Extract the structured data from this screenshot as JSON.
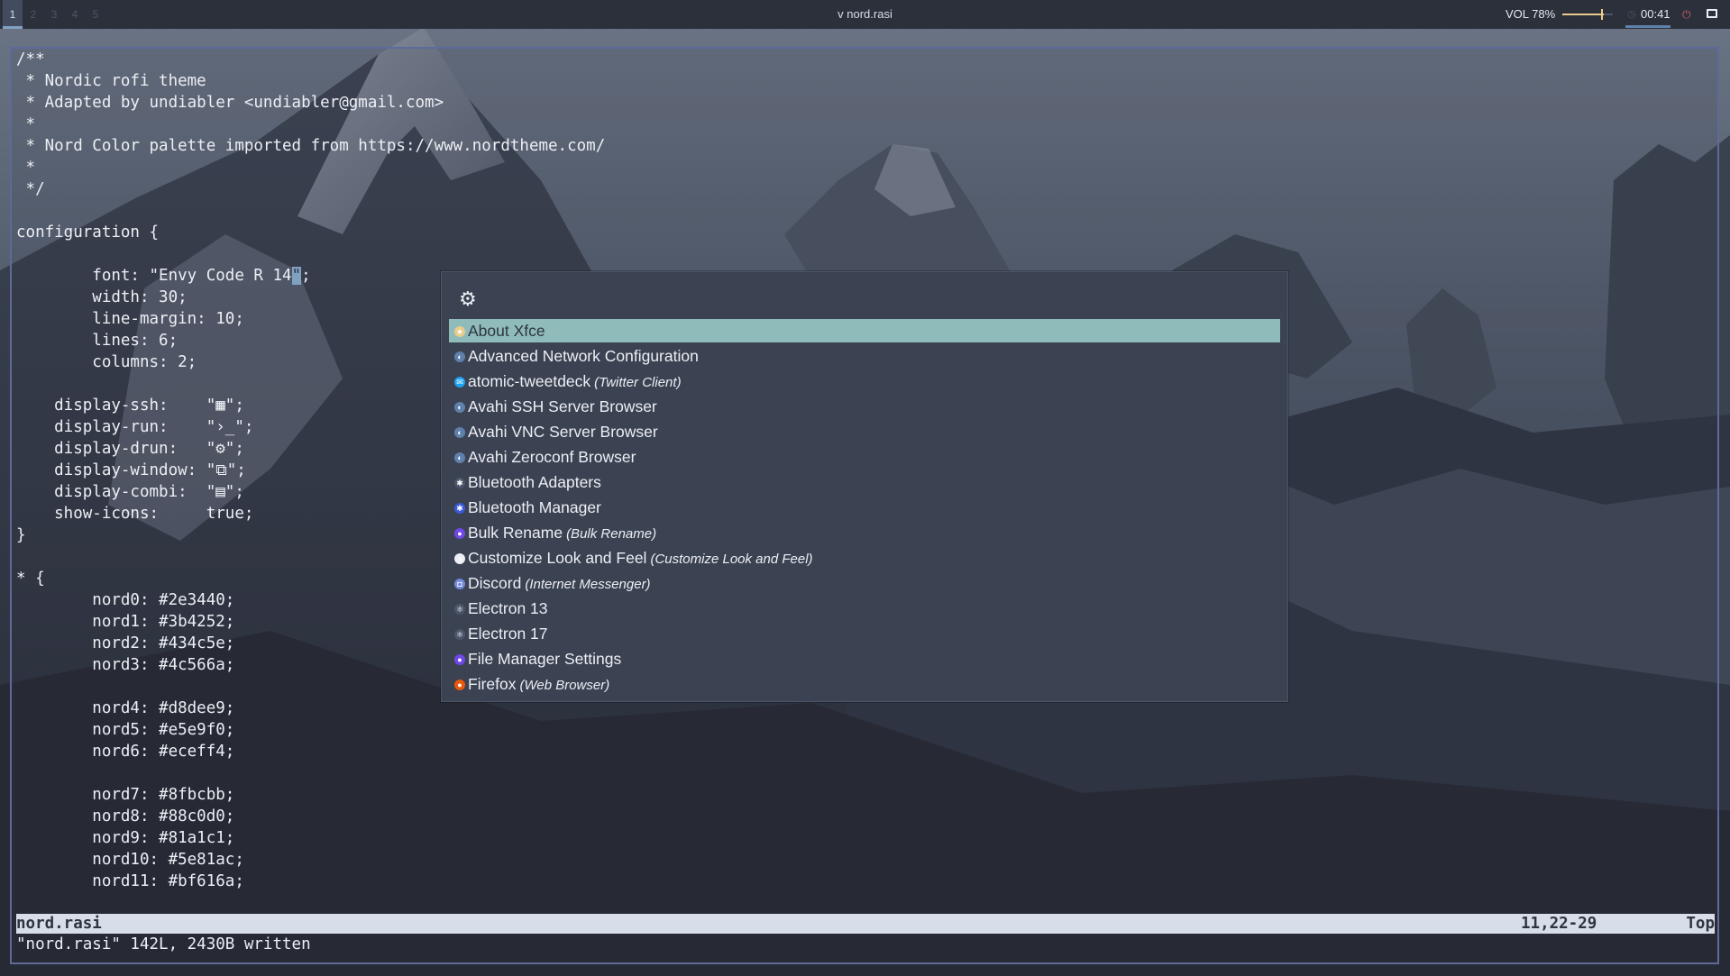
{
  "topbar": {
    "workspaces": [
      "1",
      "2",
      "3",
      "4",
      "5"
    ],
    "active_workspace": "1",
    "window_title": "v nord.rasi",
    "volume": "VOL 78%",
    "volume_level": 0.78,
    "clock": "00:41",
    "icons": [
      "clock-icon",
      "power-icon",
      "display-icon"
    ]
  },
  "editor": {
    "lines": [
      "/**",
      " * Nordic rofi theme",
      " * Adapted by undiabler <undiabler@gmail.com>",
      " *",
      " * Nord Color palette imported from https://www.nordtheme.com/",
      " *",
      " */",
      "",
      "configuration {",
      "",
      "        font: \"Envy Code R 14\";",
      "        width: 30;",
      "        line-margin: 10;",
      "        lines: 6;",
      "        columns: 2;",
      "",
      "    display-ssh:    \"▦\";",
      "    display-run:    \"›_\";",
      "    display-drun:   \"⚙\";",
      "    display-window: \"⧉\";",
      "    display-combi:  \"▤\";",
      "    show-icons:     true;",
      "}",
      "",
      "* {",
      "        nord0: #2e3440;",
      "        nord1: #3b4252;",
      "        nord2: #434c5e;",
      "        nord3: #4c566a;",
      "",
      "        nord4: #d8dee9;",
      "        nord5: #e5e9f0;",
      "        nord6: #eceff4;",
      "",
      "        nord7: #8fbcbb;",
      "        nord8: #88c0d0;",
      "        nord9: #81a1c1;",
      "        nord10: #5e81ac;",
      "        nord11: #bf616a;"
    ],
    "cursor_line": 10,
    "cursor_col": 29,
    "status": {
      "filename": "nord.rasi",
      "position": "11,22-29",
      "scroll": "Top"
    },
    "message": "\"nord.rasi\" 142L, 2430B written"
  },
  "rofi": {
    "prompt_icon": "gears-icon",
    "selected_index": 0,
    "items": [
      {
        "name": "About Xfce",
        "generic": "",
        "icon": "xfce-icon",
        "color": "#ebcb8b",
        "glyph": "★"
      },
      {
        "name": "Advanced Network Configuration",
        "generic": "",
        "icon": "network-icon",
        "color": "#5e81ac",
        "glyph": "◐"
      },
      {
        "name": "atomic-tweetdeck",
        "generic": "(Twitter Client)",
        "icon": "tweetdeck-icon",
        "color": "#1da1f2",
        "glyph": "✉"
      },
      {
        "name": "Avahi SSH Server Browser",
        "generic": "",
        "icon": "avahi-icon",
        "color": "#5e81ac",
        "glyph": "◐"
      },
      {
        "name": "Avahi VNC Server Browser",
        "generic": "",
        "icon": "avahi-icon",
        "color": "#5e81ac",
        "glyph": "◐"
      },
      {
        "name": "Avahi Zeroconf Browser",
        "generic": "",
        "icon": "avahi-icon",
        "color": "#5e81ac",
        "glyph": "◐"
      },
      {
        "name": "Bluetooth Adapters",
        "generic": "",
        "icon": "bluetooth-adapter-icon",
        "color": "#4c566a",
        "glyph": "✱"
      },
      {
        "name": "Bluetooth Manager",
        "generic": "",
        "icon": "bluetooth-icon",
        "color": "#3b5bdb",
        "glyph": "✱"
      },
      {
        "name": "Bulk Rename",
        "generic": "(Bulk Rename)",
        "icon": "bulk-rename-icon",
        "color": "#7048e8",
        "glyph": "●"
      },
      {
        "name": "Customize Look and Feel",
        "generic": "(Customize Look and Feel)",
        "icon": "appearance-icon",
        "color": "#eceff4",
        "glyph": "◑"
      },
      {
        "name": "Discord",
        "generic": "(Internet Messenger)",
        "icon": "discord-icon",
        "color": "#7289da",
        "glyph": "◘"
      },
      {
        "name": "Electron 13",
        "generic": "",
        "icon": "electron-icon",
        "color": "#4c566a",
        "glyph": "⚛"
      },
      {
        "name": "Electron 17",
        "generic": "",
        "icon": "electron-icon",
        "color": "#4c566a",
        "glyph": "⚛"
      },
      {
        "name": "File Manager Settings",
        "generic": "",
        "icon": "file-manager-icon",
        "color": "#7048e8",
        "glyph": "●"
      },
      {
        "name": "Firefox",
        "generic": "(Web Browser)",
        "icon": "firefox-icon",
        "color": "#e8590c",
        "glyph": "●"
      }
    ]
  }
}
